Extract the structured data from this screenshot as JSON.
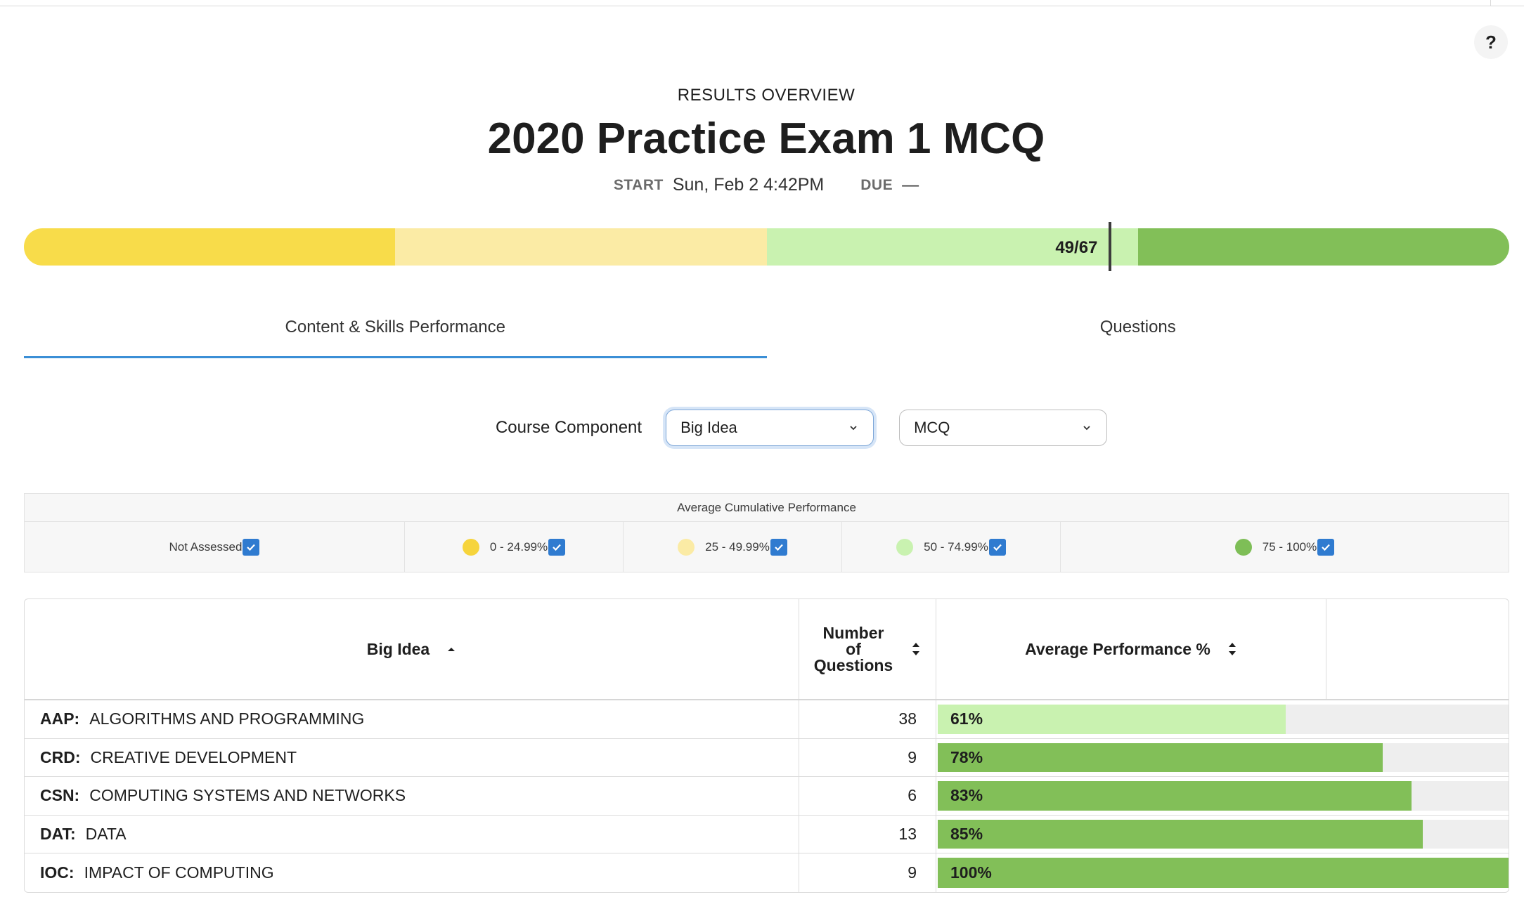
{
  "help": {
    "label": "?"
  },
  "header": {
    "overline": "RESULTS OVERVIEW",
    "title": "2020 Practice Exam 1 MCQ",
    "start_label": "START",
    "start_value": "Sun, Feb 2 4:42PM",
    "due_label": "DUE",
    "due_value": "—"
  },
  "score": {
    "label": "49/67",
    "correct": 49,
    "total": 67,
    "band_colors": [
      "#f8dc4a",
      "#fbeba5",
      "#c9f2b0",
      "#82bf58"
    ]
  },
  "tabs": [
    {
      "label": "Content & Skills Performance",
      "active": true
    },
    {
      "label": "Questions",
      "active": false
    }
  ],
  "filters": {
    "label": "Course Component",
    "component_value": "Big Idea",
    "type_value": "MCQ"
  },
  "legend": {
    "title": "Average Cumulative Performance",
    "items": [
      {
        "label": "Not Assessed",
        "color": "",
        "checked": true
      },
      {
        "label": "0 - 24.99%",
        "color": "#f6d43c",
        "checked": true
      },
      {
        "label": "25 - 49.99%",
        "color": "#fbeba5",
        "checked": true
      },
      {
        "label": "50 - 74.99%",
        "color": "#c9f2b0",
        "checked": true
      },
      {
        "label": "75 - 100%",
        "color": "#7ebe57",
        "checked": true
      }
    ]
  },
  "table": {
    "headers": {
      "big_idea": "Big Idea",
      "num_questions_line1": "Number",
      "num_questions_line2": "of",
      "num_questions_line3": "Questions",
      "avg_perf": "Average Performance %"
    },
    "rows": [
      {
        "code": "AAP:",
        "name": "ALGORITHMS AND PROGRAMMING",
        "questions": "38",
        "perf": "61%",
        "perf_value": 61,
        "color": "#c9f2b0"
      },
      {
        "code": "CRD:",
        "name": "CREATIVE DEVELOPMENT",
        "questions": "9",
        "perf": "78%",
        "perf_value": 78,
        "color": "#82bf58"
      },
      {
        "code": "CSN:",
        "name": "COMPUTING SYSTEMS AND NETWORKS",
        "questions": "6",
        "perf": "83%",
        "perf_value": 83,
        "color": "#82bf58"
      },
      {
        "code": "DAT:",
        "name": "DATA",
        "questions": "13",
        "perf": "85%",
        "perf_value": 85,
        "color": "#82bf58"
      },
      {
        "code": "IOC:",
        "name": "IMPACT OF COMPUTING",
        "questions": "9",
        "perf": "100%",
        "perf_value": 100,
        "color": "#82bf58"
      }
    ]
  }
}
